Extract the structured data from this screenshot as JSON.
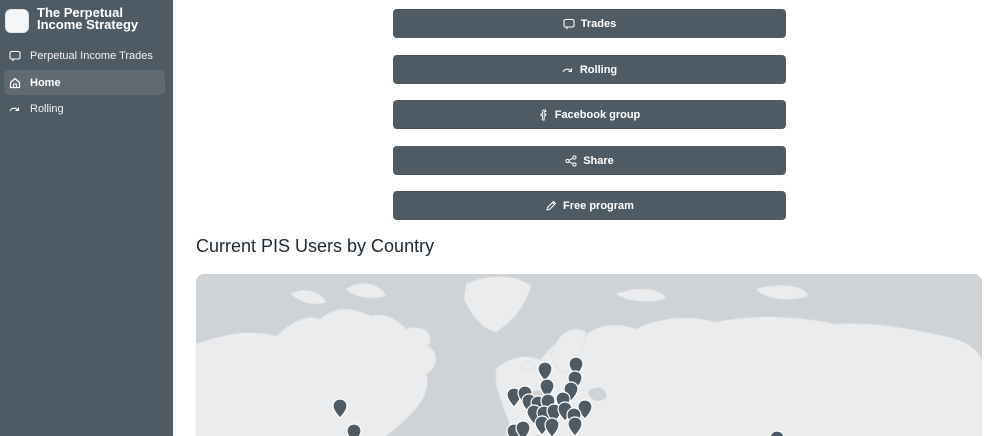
{
  "app": {
    "title": "The Perpetual Income Strategy"
  },
  "sidebar": {
    "items": [
      {
        "label": "Perpetual Income Trades",
        "icon": "chat-icon"
      },
      {
        "label": "Home",
        "icon": "home-icon",
        "active": true
      },
      {
        "label": "Rolling",
        "icon": "redo-icon"
      }
    ]
  },
  "buttons": [
    {
      "label": "Trades",
      "icon": "chat-icon"
    },
    {
      "label": "Rolling",
      "icon": "redo-icon"
    },
    {
      "label": "Facebook group",
      "icon": "facebook-icon"
    },
    {
      "label": "Share",
      "icon": "share-icon"
    },
    {
      "label": "Free program",
      "icon": "pencil-icon"
    }
  ],
  "section": {
    "title": "Current PIS Users by Country"
  },
  "colors": {
    "sidebar_bg": "#4f5b64",
    "button_bg": "#4f5b64",
    "map_water": "#cfd3d6",
    "map_land": "#eaecee",
    "marker": "#4f5b64"
  }
}
